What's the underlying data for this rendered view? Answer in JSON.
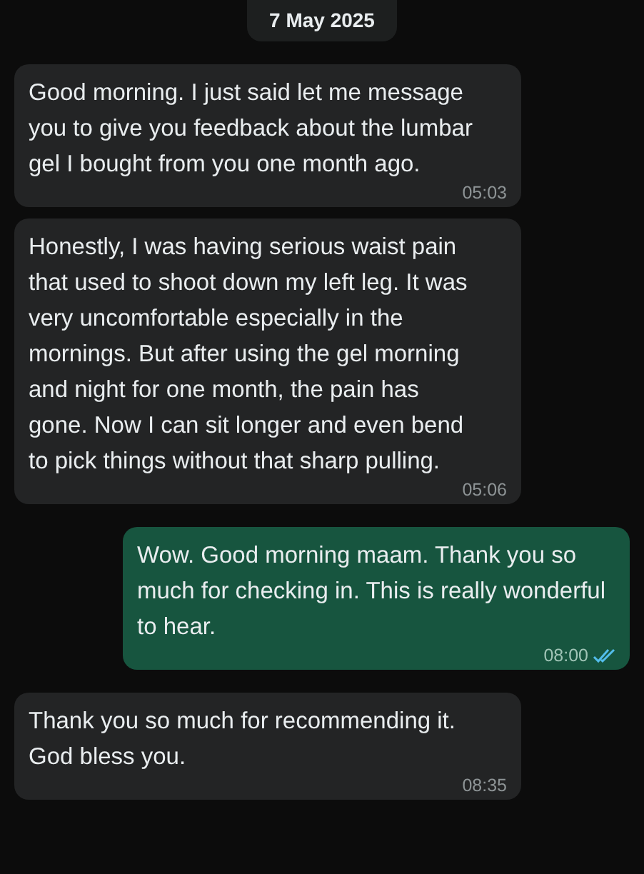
{
  "date_divider": "7 May 2025",
  "messages": [
    {
      "kind": "incoming",
      "text": "Good morning. I just said let me message you to give you feedback about the lumbar gel I bought from you one month ago.",
      "time": "05:03"
    },
    {
      "kind": "incoming",
      "text": "Honestly, I was having serious waist pain that used to shoot down my left leg. It was very uncomfortable especially in the mornings. But after using the gel morning and night for one month, the pain has gone. Now I can sit longer and even bend to pick things without that sharp pulling.",
      "time": "05:06"
    },
    {
      "kind": "outgoing",
      "text": "Wow. Good morning maam. Thank you so much for checking in. This is really wonderful to hear.",
      "time": "08:00",
      "read": true
    },
    {
      "kind": "incoming",
      "text": "Thank you so much for recommending it. God bless you.",
      "time": "08:35"
    }
  ]
}
